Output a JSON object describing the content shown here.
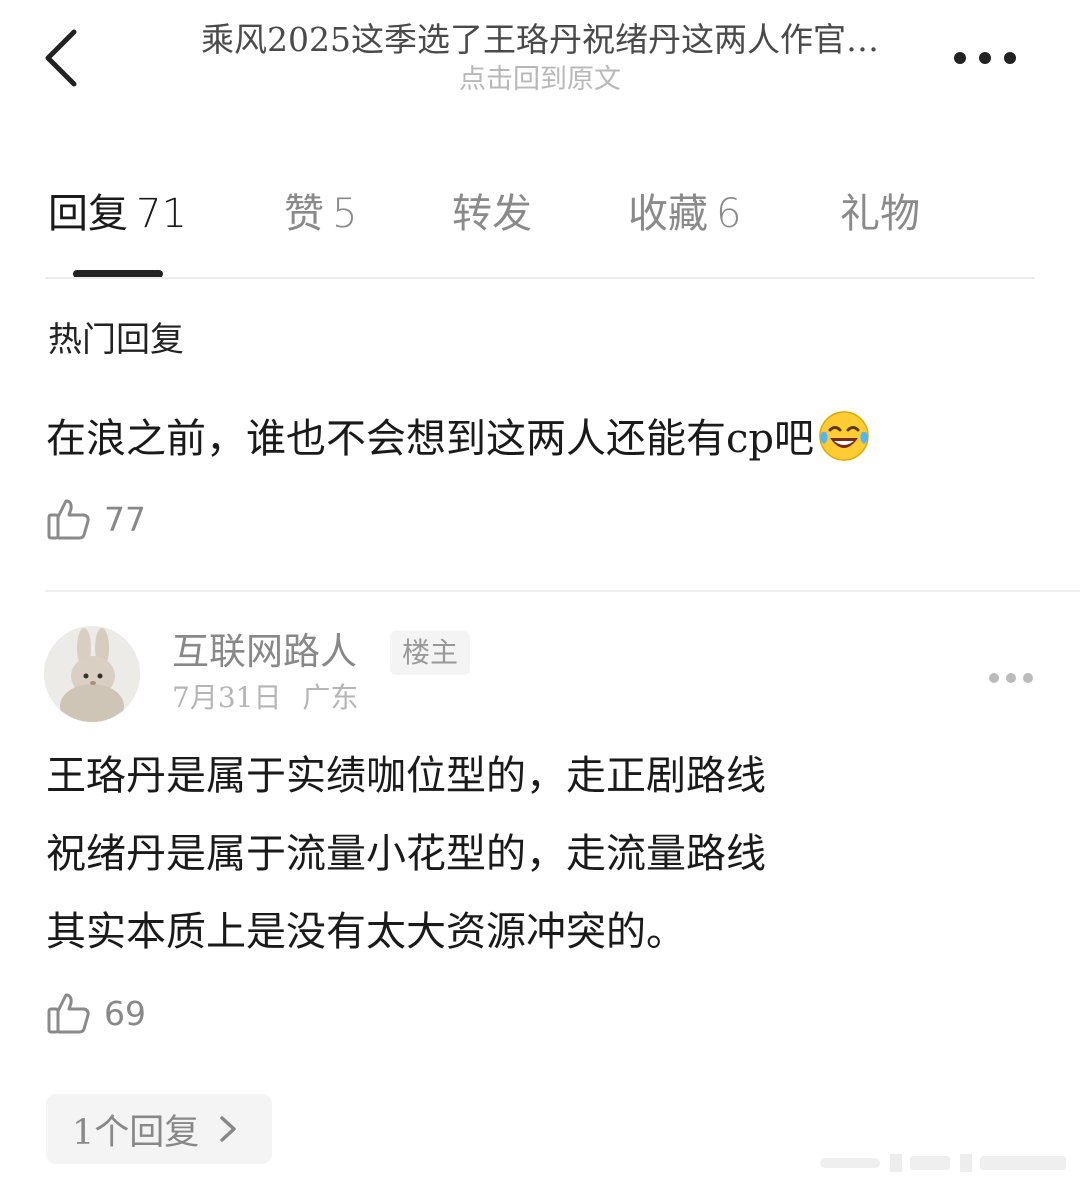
{
  "header": {
    "title": "乘风2025这季选了王珞丹祝绪丹这两人作官…",
    "subtitle": "点击回到原文"
  },
  "tabs": [
    {
      "label": "回复",
      "count": "71",
      "active": true
    },
    {
      "label": "赞",
      "count": "5",
      "active": false
    },
    {
      "label": "转发",
      "count": "",
      "active": false
    },
    {
      "label": "收藏",
      "count": "6",
      "active": false
    },
    {
      "label": "礼物",
      "count": "",
      "active": false
    }
  ],
  "section_title": "热门回复",
  "hot_reply": {
    "text": "在浪之前，谁也不会想到这两人还能有cp吧",
    "emoji": "laughing-tears",
    "likes": "77"
  },
  "comment": {
    "username": "互联网路人",
    "badge": "楼主",
    "date": "7月31日",
    "location": "广东",
    "lines": [
      "王珞丹是属于实绩咖位型的，走正剧路线",
      "祝绪丹是属于流量小花型的，走流量路线",
      "其实本质上是没有太大资源冲突的。"
    ],
    "likes": "69",
    "replies_label": "1个回复"
  }
}
